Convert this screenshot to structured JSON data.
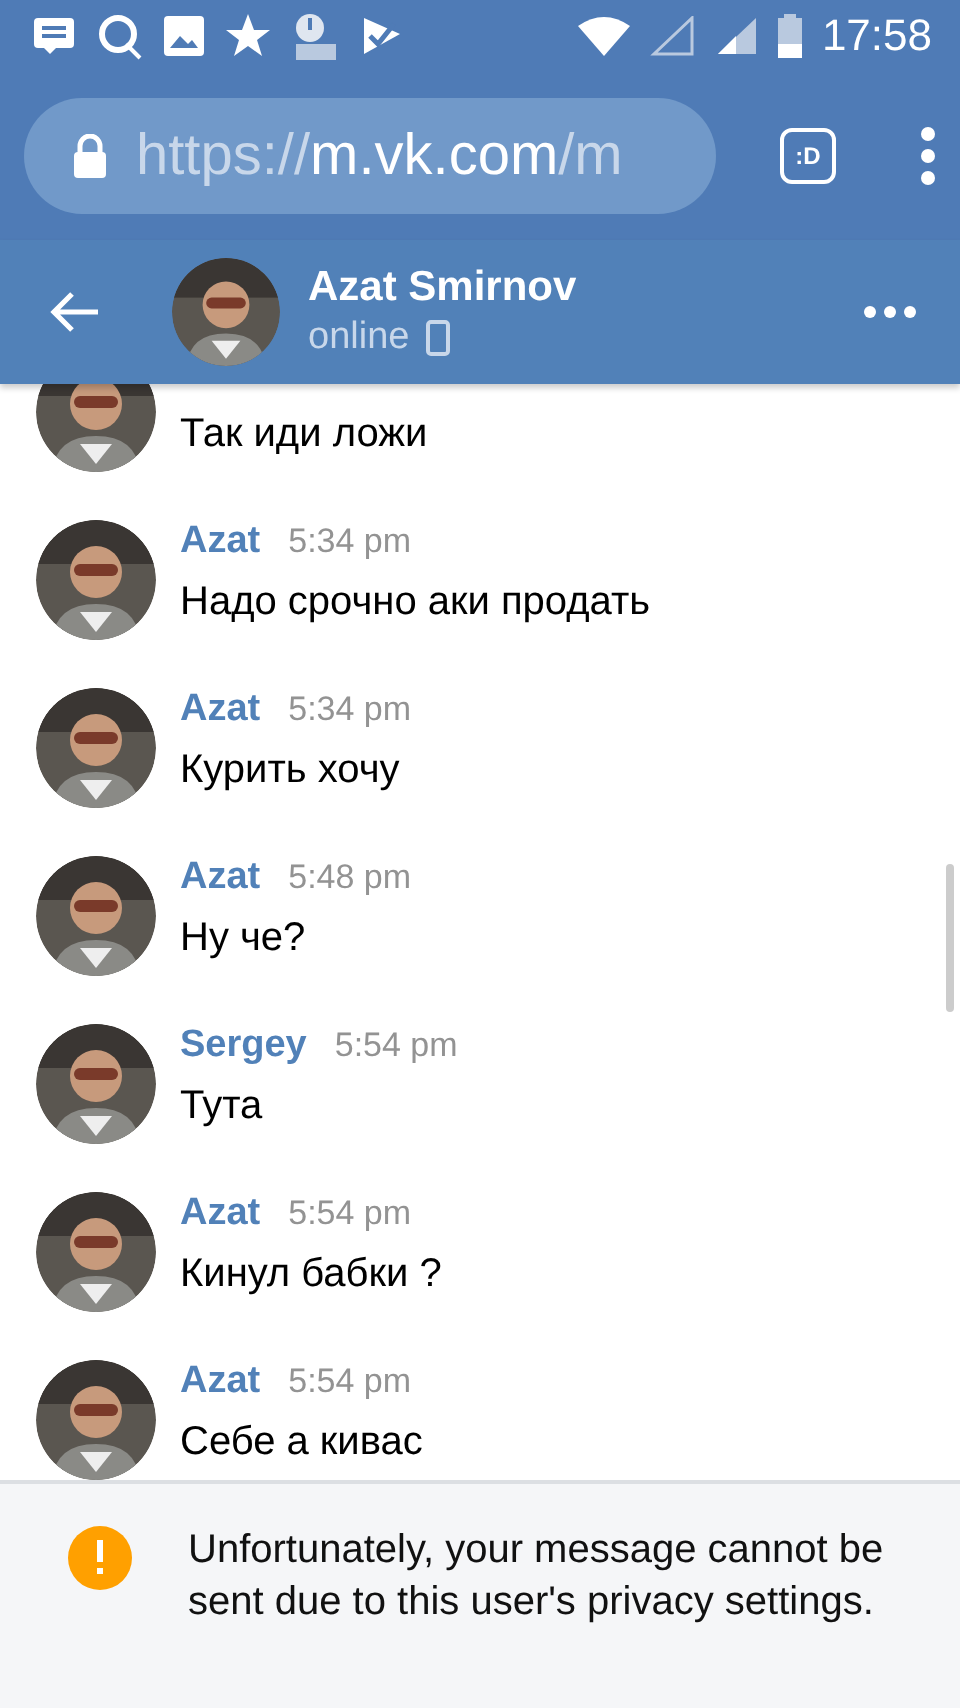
{
  "status_bar": {
    "time": "17:58"
  },
  "browser": {
    "url_scheme": "https://",
    "url_host": "m.vk.com",
    "url_path": "/m",
    "tabs_label": ":D"
  },
  "chat_header": {
    "name": "Azat Smirnov",
    "status": "online"
  },
  "messages": [
    {
      "text": "Так иди ложи"
    },
    {
      "sender": "Azat",
      "time": "5:34 pm",
      "text": "Надо срочно аки продать"
    },
    {
      "sender": "Azat",
      "time": "5:34 pm",
      "text": "Курить хочу"
    },
    {
      "sender": "Azat",
      "time": "5:48 pm",
      "text": "Ну че?"
    },
    {
      "sender": "Sergey",
      "time": "5:54 pm",
      "text": "Тута"
    },
    {
      "sender": "Azat",
      "time": "5:54 pm",
      "text": "Кинул бабки ?"
    },
    {
      "sender": "Azat",
      "time": "5:54 pm",
      "text": "Себе а кивас"
    }
  ],
  "notice": {
    "text": "Unfortunately, your message cannot be sent due to this user's privacy settings."
  }
}
